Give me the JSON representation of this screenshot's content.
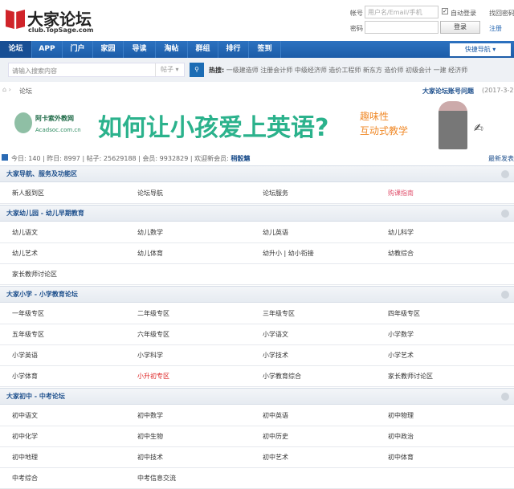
{
  "header": {
    "logo_title": "大家论坛",
    "logo_sub": "club.TopSage.com",
    "account_label": "帐号",
    "account_placeholder": "用户名/Email/手机",
    "auto_login": "自动登录",
    "find_password": "找回密码",
    "password_label": "密码",
    "login": "登录",
    "register": "注册"
  },
  "nav": {
    "items": [
      "论坛",
      "APP",
      "门户",
      "家园",
      "导读",
      "淘帖",
      "群组",
      "排行",
      "签到"
    ],
    "quick": "快捷导航 ▾"
  },
  "search": {
    "placeholder": "请输入搜索内容",
    "type": "帖子 ▾",
    "hot_label": "热搜:",
    "hot": [
      "一级建造师",
      "注册会计师",
      "中级经济师",
      "造价工程师",
      "新东方",
      "造价师",
      "初级会计",
      "一建",
      "经济师"
    ]
  },
  "breadcrumb": {
    "current": "论坛",
    "notice": "大家论坛账号问题",
    "notice_date": "(2017-3-2)"
  },
  "banner": {
    "brand": "阿卡索外教网",
    "brand_url": "Acadsoc.com.cn",
    "headline": "如何让小孩爱上英语?",
    "tag1": "趣味性",
    "tag2": "互动式教学",
    "person": "代言人"
  },
  "stats": {
    "today": "今日: 140",
    "yesterday": "昨日: 8997",
    "posts": "帖子: 25629188",
    "members": "会员: 9932829",
    "welcome": "欢迎新会员:",
    "new_member": "稍骰魑",
    "latest": "最新发表"
  },
  "colors": {
    "nav": "#1c5ca8",
    "section_title": "#1d4f8c",
    "highlight": "#e0526e",
    "red": "#d22"
  },
  "sections": [
    {
      "title": "大家导航、服务及功能区",
      "rows": [
        [
          "新人报到区",
          "论坛导航",
          "论坛服务",
          "购课指南"
        ]
      ]
    },
    {
      "title": "大家幼儿园 - 幼儿早期教育",
      "rows": [
        [
          "幼儿语文",
          "幼儿数学",
          "幼儿英语",
          "幼儿科学"
        ],
        [
          "幼儿艺术",
          "幼儿体育",
          "幼升小 | 幼小衔接",
          "幼教综合"
        ],
        [
          "家长教师讨论区"
        ]
      ]
    },
    {
      "title": "大家小学 - 小学教育论坛",
      "rows": [
        [
          "一年级专区",
          "二年级专区",
          "三年级专区",
          "四年级专区"
        ],
        [
          "五年级专区",
          "六年级专区",
          "小学语文",
          "小学数学"
        ],
        [
          "小学英语",
          "小学科学",
          "小学技术",
          "小学艺术"
        ],
        [
          "小学体育",
          "小升初专区",
          "小学教育综合",
          "家长教师讨论区"
        ]
      ]
    },
    {
      "title": "大家初中 - 中考论坛",
      "rows": [
        [
          "初中语文",
          "初中数学",
          "初中英语",
          "初中物理"
        ],
        [
          "初中化学",
          "初中生物",
          "初中历史",
          "初中政治"
        ],
        [
          "初中地理",
          "初中技术",
          "初中艺术",
          "初中体育"
        ],
        [
          "中考综合",
          "中考信息交流"
        ]
      ]
    }
  ]
}
